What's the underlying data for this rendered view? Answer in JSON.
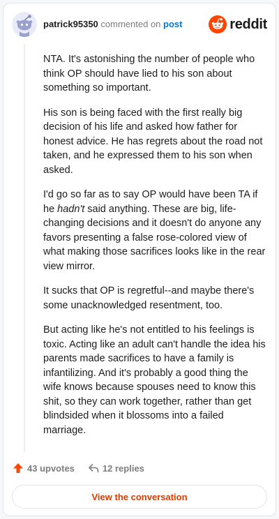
{
  "header": {
    "username": "patrick95350",
    "action_text": "commented on",
    "post_link": "post",
    "logo_text": "reddit"
  },
  "comment": {
    "paragraphs": [
      {
        "parts": [
          {
            "text": "NTA. It's astonishing the number of people who think OP should have lied to his son about something so important.",
            "italic": false
          }
        ]
      },
      {
        "parts": [
          {
            "text": "His son is being faced with the first really big decision of his life and asked how father for honest advice. He has regrets about the road not taken, and he expressed them to his son when asked.",
            "italic": false
          }
        ]
      },
      {
        "parts": [
          {
            "text": "I'd go so far as to say OP would have been TA if he ",
            "italic": false
          },
          {
            "text": "hadn't",
            "italic": true
          },
          {
            "text": " said anything. These are big, life-changing decisions and it doesn't do anyone any favors presenting a false rose-colored view of what making those sacrifices looks like in the rear view mirror.",
            "italic": false
          }
        ]
      },
      {
        "parts": [
          {
            "text": "It sucks that OP is regretful--and maybe there's some unacknowledged resentment, too.",
            "italic": false
          }
        ]
      },
      {
        "parts": [
          {
            "text": "But acting like he's not entitled to his feelings is toxic. Acting like an adult can't handle the idea his parents made sacrifices to have a family is infantilizing. And it's probably a good thing the wife knows because spouses need to know this shit, so they can work together, rather than get blindsided when it blossoms into a failed marriage.",
            "italic": false
          }
        ]
      }
    ]
  },
  "footer": {
    "upvotes_label": "43 upvotes",
    "upvote_icon": "upvote-arrow-icon",
    "replies_label": "12 replies",
    "reply_icon": "reply-arrow-icon",
    "view_button_label": "View the conversation"
  },
  "colors": {
    "accent": "#ff4500",
    "link": "#0079d3",
    "button_text": "#d93a00",
    "text": "#1c1c1c",
    "muted": "#7c7c7c"
  }
}
